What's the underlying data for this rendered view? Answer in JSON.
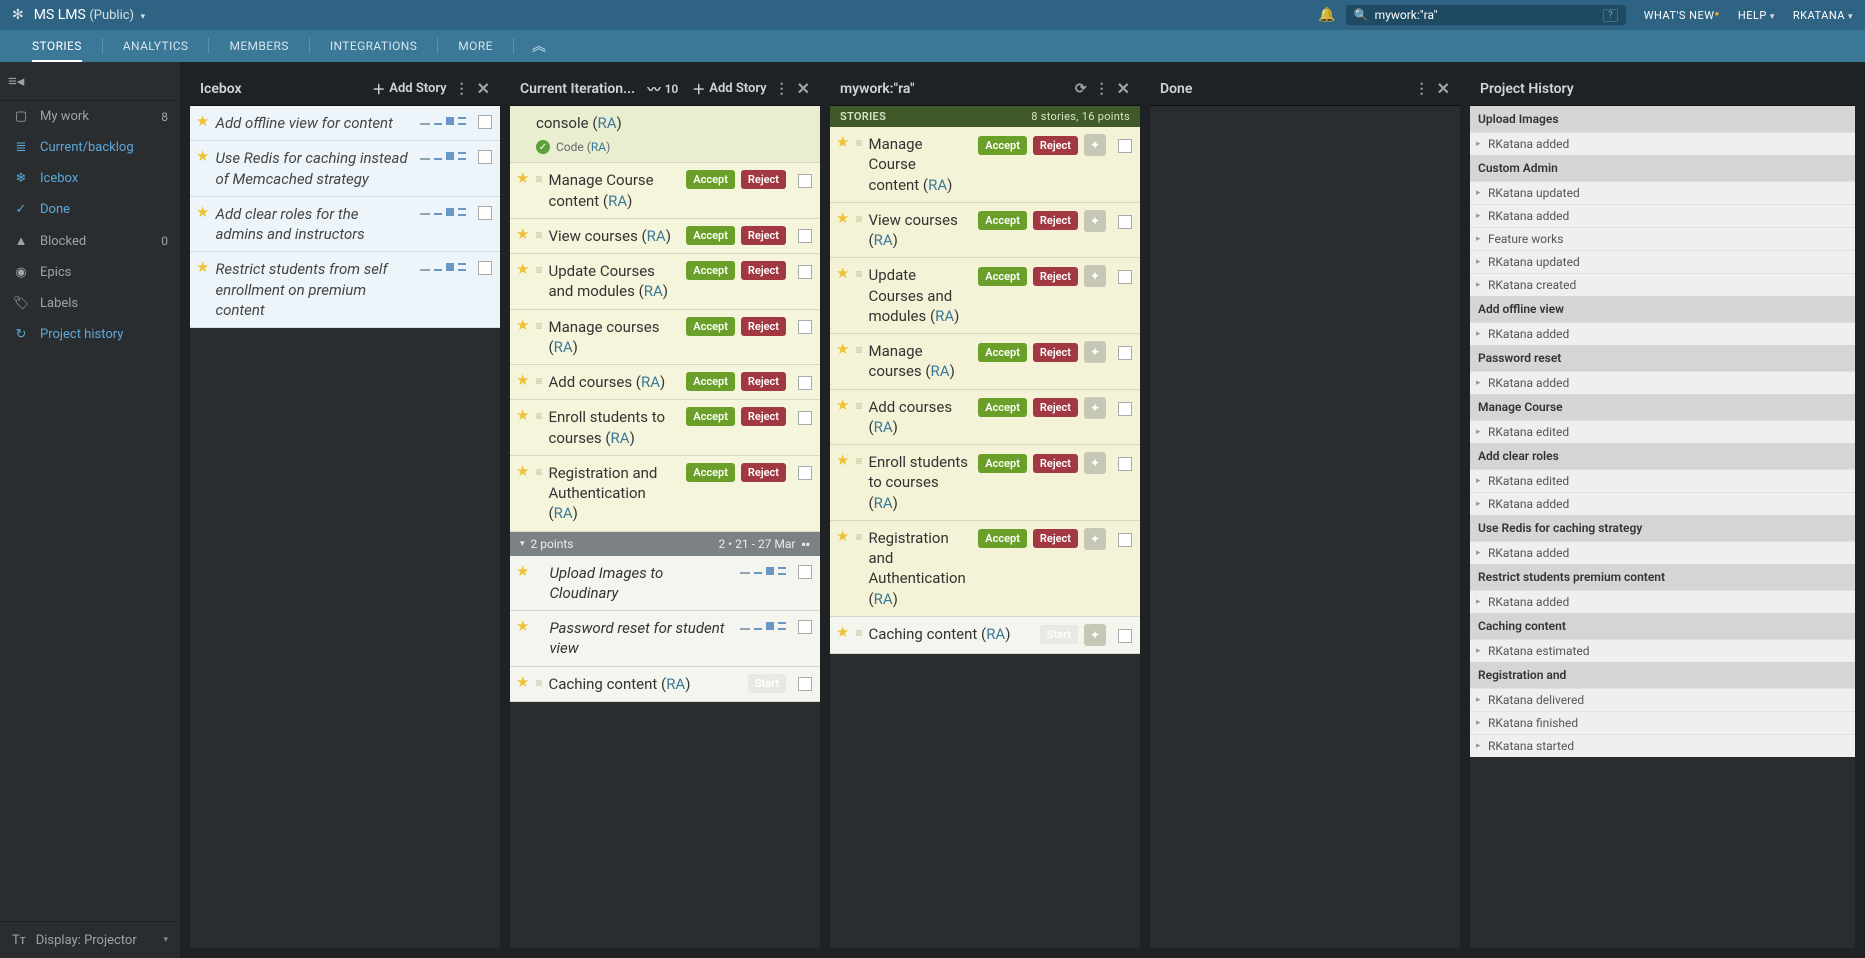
{
  "topbar": {
    "title": "MS LMS",
    "visibility": "(Public)",
    "search_value": "mywork:\"ra\"",
    "whats_new": "WHAT'S NEW",
    "help": "HELP",
    "user": "RKATANA"
  },
  "nav": {
    "items": [
      "STORIES",
      "ANALYTICS",
      "MEMBERS",
      "INTEGRATIONS",
      "MORE"
    ],
    "active": 0
  },
  "sidebar": {
    "my_work": {
      "label": "My work",
      "count": "8"
    },
    "current": {
      "label": "Current/backlog"
    },
    "icebox": {
      "label": "Icebox"
    },
    "done": {
      "label": "Done"
    },
    "blocked": {
      "label": "Blocked",
      "count": "0"
    },
    "epics": {
      "label": "Epics"
    },
    "labels": {
      "label": "Labels"
    },
    "history": {
      "label": "Project history"
    },
    "display": {
      "label": "Display: Projector"
    }
  },
  "panels": {
    "icebox": {
      "title": "Icebox",
      "add": "Add Story"
    },
    "current": {
      "title": "Current Iteration...",
      "add": "Add Story",
      "velocity": "10"
    },
    "mywork": {
      "title": "mywork:\"ra\"",
      "stories_label": "STORIES",
      "stories_meta": "8 stories, 16 points"
    },
    "done": {
      "title": "Done"
    },
    "history": {
      "title": "Project History"
    }
  },
  "btn": {
    "accept": "Accept",
    "reject": "Reject",
    "start": "Start"
  },
  "owner": "RA",
  "icebox_stories": [
    "Add offline view for content",
    "Use Redis for caching instead of Memcached strategy",
    "Add clear roles for the admins and instructors",
    "Restrict students from self enrollment on premium content"
  ],
  "current": {
    "top": {
      "title_tail": "console",
      "code_label": "Code"
    },
    "delivered": [
      "Manage Course content",
      "View courses",
      "Update Courses and modules",
      "Manage courses",
      "Add courses",
      "Enroll students to courses",
      "Registration and Authentication"
    ],
    "iter": {
      "points": "2 points",
      "range": "2 • 21 - 27 Mar"
    },
    "next": [
      "Upload Images to Cloudinary",
      "Password reset for student view"
    ],
    "caching": "Caching content"
  },
  "mywork": [
    "Manage Course content",
    "View courses",
    "Update Courses and modules",
    "Manage courses",
    "Add courses",
    "Enroll students to courses",
    "Registration and Authentication",
    "Caching content"
  ],
  "history": [
    {
      "h": "Upload Images",
      "l": [
        "RKatana added"
      ]
    },
    {
      "h": "Custom Admin",
      "l": [
        "RKatana updated",
        "RKatana added",
        "Feature works",
        "RKatana updated",
        "RKatana created"
      ]
    },
    {
      "h": "Add offline view",
      "l": [
        "RKatana added"
      ]
    },
    {
      "h": "Password reset",
      "l": [
        "RKatana added"
      ]
    },
    {
      "h": "Manage Course",
      "l": [
        "RKatana edited"
      ]
    },
    {
      "h": "Add clear roles",
      "l": [
        "RKatana edited",
        "RKatana added"
      ]
    },
    {
      "h": "Use Redis for caching strategy",
      "l": [
        "RKatana added"
      ]
    },
    {
      "h": "Restrict students premium content",
      "l": [
        "RKatana added"
      ]
    },
    {
      "h": "Caching content",
      "l": [
        "RKatana estimated"
      ]
    },
    {
      "h": "Registration and",
      "l": [
        "RKatana delivered",
        "RKatana finished",
        "RKatana started"
      ]
    }
  ]
}
